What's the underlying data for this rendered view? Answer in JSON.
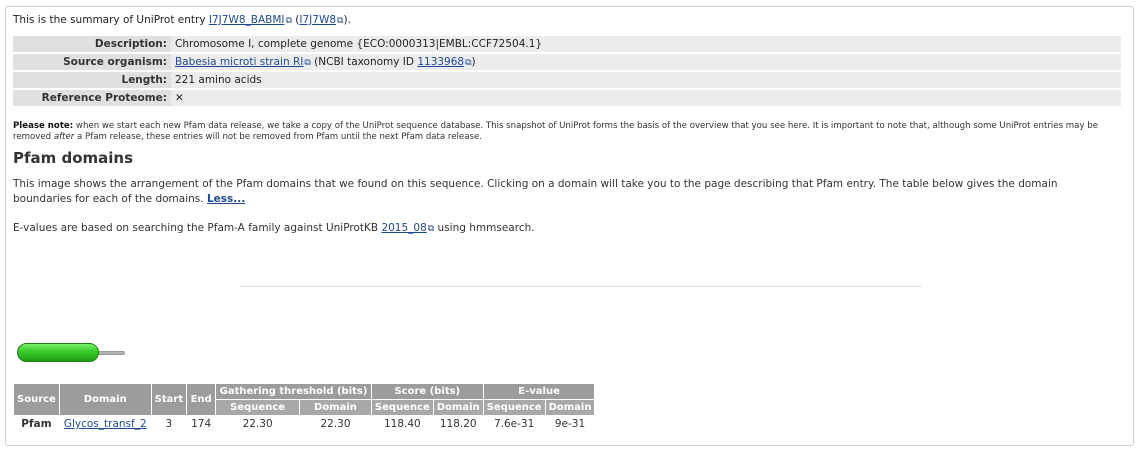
{
  "intro": {
    "prefix": "This is the summary of UniProt entry ",
    "entry_name": "I7J7W8_BABMI",
    "accession": "I7J7W8",
    "suffix": ")."
  },
  "summary": {
    "rows": [
      {
        "key": "Description:",
        "value": "Chromosome I, complete genome {ECO:0000313|EMBL:CCF72504.1}"
      },
      {
        "key": "Source organism:",
        "organism": "Babesia microti strain RI",
        "taxon_prefix": "(NCBI taxonomy ID ",
        "taxon_id": "1133968",
        "taxon_suffix": ")"
      },
      {
        "key": "Length:",
        "value": "221 amino acids"
      },
      {
        "key": "Reference Proteome:",
        "value": "✕"
      }
    ]
  },
  "note": {
    "label": "Please note:",
    "part1": " when we start each new Pfam data release, we take a copy of the UniProt sequence database. This snapshot of UniProt forms the basis of the overview that you see here. It is important to note that, although some UniProt entries may be removed ",
    "emph": "after",
    "part2": " a Pfam release, these entries will not be removed from Pfam until the next Pfam data release."
  },
  "pfam": {
    "heading": "Pfam domains",
    "description": "This image shows the arrangement of the Pfam domains that we found on this sequence. Clicking on a domain will take you to the page describing that Pfam entry. The table below gives the domain boundaries for each of the domains. ",
    "less_link": "Less...",
    "evalue_prefix": "E-values are based on searching the Pfam-A family against UniProtKB ",
    "evalue_release": "2015_08",
    "evalue_suffix": " using hmmsearch."
  },
  "domain_graphic": {
    "sequence_length": 221,
    "domain_start": 3,
    "domain_end": 174,
    "domain_color": "#3dcf2d"
  },
  "domain_table": {
    "headers": {
      "source": "Source",
      "domain": "Domain",
      "start": "Start",
      "end": "End",
      "gathering": "Gathering threshold (bits)",
      "score": "Score (bits)",
      "evalue": "E-value",
      "sequence": "Sequence",
      "domain_sub": "Domain"
    },
    "rows": [
      {
        "source": "Pfam",
        "domain": "Glycos_transf_2",
        "start": "3",
        "end": "174",
        "ga_seq": "22.30",
        "ga_dom": "22.30",
        "score_seq": "118.40",
        "score_dom": "118.20",
        "evalue_seq": "7.6e-31",
        "evalue_dom": "9e-31"
      }
    ]
  }
}
